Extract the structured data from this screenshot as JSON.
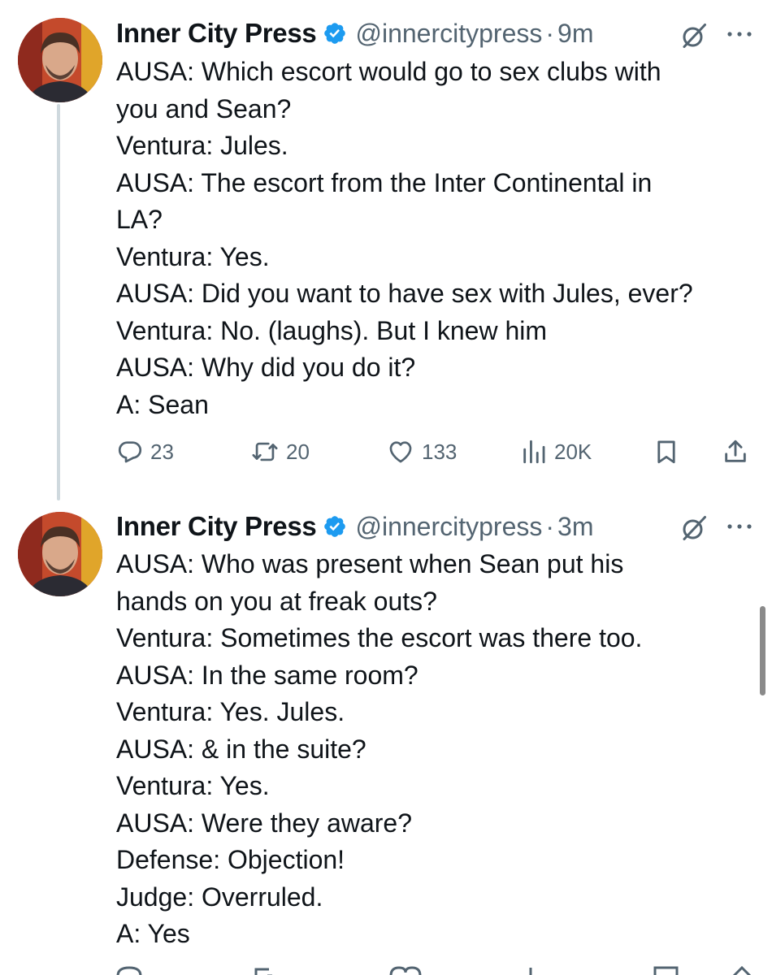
{
  "colors": {
    "text": "#0f1419",
    "secondary": "#536471",
    "verified": "#1d9bf0",
    "thread_line": "#cfd9de"
  },
  "tweets": [
    {
      "author": "Inner City Press",
      "handle": "@innercitypress",
      "separator": "·",
      "time": "9m",
      "icons": [
        "verified-badge-icon",
        "grok-icon",
        "more-icon"
      ],
      "lines": [
        "AUSA: Which escort would go to sex clubs with",
        "you and Sean?",
        "Ventura: Jules.",
        "AUSA: The escort from the Inter Continental in",
        "LA?",
        "Ventura: Yes.",
        "AUSA: Did you want to have sex with Jules, ever?",
        "Ventura: No. (laughs). But I knew him",
        "AUSA: Why did you do it?",
        "A: Sean"
      ],
      "actions": {
        "replies": "23",
        "reposts": "20",
        "likes": "133",
        "views": "20K"
      }
    },
    {
      "author": "Inner City Press",
      "handle": "@innercitypress",
      "separator": "·",
      "time": "3m",
      "icons": [
        "verified-badge-icon",
        "grok-icon",
        "more-icon"
      ],
      "lines": [
        "AUSA: Who was present when Sean put his",
        "hands on you at freak outs?",
        "Ventura: Sometimes the escort was there too.",
        "AUSA: In the same room?",
        "Ventura: Yes. Jules.",
        "AUSA: & in the suite?",
        "Ventura: Yes.",
        "AUSA: Were they aware?",
        "Defense: Objection!",
        "Judge: Overruled.",
        "A: Yes"
      ]
    }
  ]
}
